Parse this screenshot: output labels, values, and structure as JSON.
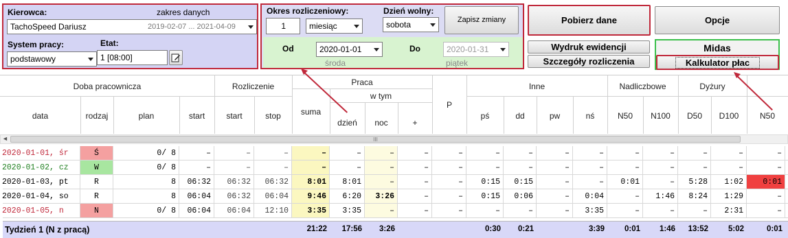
{
  "panel": {
    "driver_label": "Kierowca:",
    "range_label": "zakres danych",
    "driver_name": "TachoSpeed Dariusz",
    "date_range": "2019-02-07 ... 2021-04-09",
    "work_system_label": "System pracy:",
    "etat_label": "Etat:",
    "work_system": "podstawowy",
    "etat": "1 [08:00]"
  },
  "settlement": {
    "period_label": "Okres rozliczeniowy:",
    "period_count": "1",
    "period_unit": "miesiąc",
    "day_off_label": "Dzień wolny:",
    "day_off": "sobota",
    "save_label": "Zapisz zmiany",
    "from_label": "Od",
    "from_date": "2020-01-01",
    "from_day": "środa",
    "to_label": "Do",
    "to_date": "2020-01-31",
    "to_day": "piątek"
  },
  "buttons": {
    "fetch": "Pobierz dane",
    "options": "Opcje",
    "print": "Wydruk ewidencji",
    "details": "Szczegóły rozliczenia",
    "midas": "Midas",
    "salary": "Kalkulator płac"
  },
  "columns": {
    "doba": "Doba pracownicza",
    "rozliczenie": "Rozliczenie",
    "praca": "Praca",
    "w_tym": "w tym",
    "p": "P",
    "inne": "Inne",
    "nadliczbowe": "Nadliczbowe",
    "dyzury": "Dyżury",
    "data": "data",
    "rodzaj": "rodzaj",
    "plan": "plan",
    "start": "start",
    "r_start": "start",
    "r_stop": "stop",
    "suma": "suma",
    "dzien": "dzień",
    "noc": "noc",
    "plus": "+",
    "ps": "pś",
    "dd": "dd",
    "pw": "pw",
    "ns": "nś",
    "n50": "N50",
    "n100": "N100",
    "d50": "D50",
    "d100": "D100",
    "n50b": "N50"
  },
  "scrollbar": {
    "grip": "III"
  },
  "rows": [
    {
      "date": "2020-01-01, śr",
      "kind": "Ś",
      "plan": "0/ 8",
      "start": "–",
      "rs": "–",
      "re": "–",
      "sum": "–",
      "day": "–",
      "night": "–",
      "plus": "–",
      "p": "–",
      "ps": "–",
      "dd": "–",
      "pw": "–",
      "ns": "–",
      "n50": "–",
      "n100": "–",
      "d50": "–",
      "d100": "–",
      "n50b": "–"
    },
    {
      "date": "2020-01-02, cz",
      "kind": "W",
      "plan": "0/ 8",
      "start": "–",
      "rs": "–",
      "re": "–",
      "sum": "–",
      "day": "–",
      "night": "–",
      "plus": "–",
      "p": "–",
      "ps": "–",
      "dd": "–",
      "pw": "–",
      "ns": "–",
      "n50": "–",
      "n100": "–",
      "d50": "–",
      "d100": "–",
      "n50b": "–"
    },
    {
      "date": "2020-01-03, pt",
      "kind": "R",
      "plan": "8",
      "start": "06:32",
      "rs": "06:32",
      "re": "06:32",
      "sum": "8:01",
      "day": "8:01",
      "night": "–",
      "plus": "–",
      "p": "–",
      "ps": "0:15",
      "dd": "0:15",
      "pw": "–",
      "ns": "–",
      "n50": "0:01",
      "n100": "–",
      "d50": "5:28",
      "d100": "1:02",
      "n50b": "0:01"
    },
    {
      "date": "2020-01-04, so",
      "kind": "R",
      "plan": "8",
      "start": "06:04",
      "rs": "06:32",
      "re": "06:04",
      "sum": "9:46",
      "day": "6:20",
      "night": "3:26",
      "plus": "–",
      "p": "–",
      "ps": "0:15",
      "dd": "0:06",
      "pw": "–",
      "ns": "0:04",
      "n50": "–",
      "n100": "1:46",
      "d50": "8:24",
      "d100": "1:29",
      "n50b": "–"
    },
    {
      "date": "2020-01-05, n",
      "kind": "N",
      "plan": "0/ 8",
      "start": "06:04",
      "rs": "06:04",
      "re": "12:10",
      "sum": "3:35",
      "day": "3:35",
      "night": "–",
      "plus": "–",
      "p": "–",
      "ps": "–",
      "dd": "–",
      "pw": "–",
      "ns": "3:35",
      "n50": "–",
      "n100": "–",
      "d50": "–",
      "d100": "2:31",
      "n50b": "–"
    }
  ],
  "summary": {
    "label": "Tydzień 1 (N z pracą)",
    "sum": "21:22",
    "day": "17:56",
    "night": "3:26",
    "ps": "0:30",
    "dd": "0:21",
    "ns": "3:39",
    "n50": "0:01",
    "n100": "1:46",
    "d50": "13:52",
    "d100": "5:02",
    "n50b": "0:01"
  },
  "colors": {
    "accent": "#c0283a",
    "holiday": "#f4a0a0",
    "free": "#a8e6a0",
    "sum_col": "#fbf7c0",
    "summary_bg": "#d8d8f8",
    "overtime": "#f04040"
  }
}
